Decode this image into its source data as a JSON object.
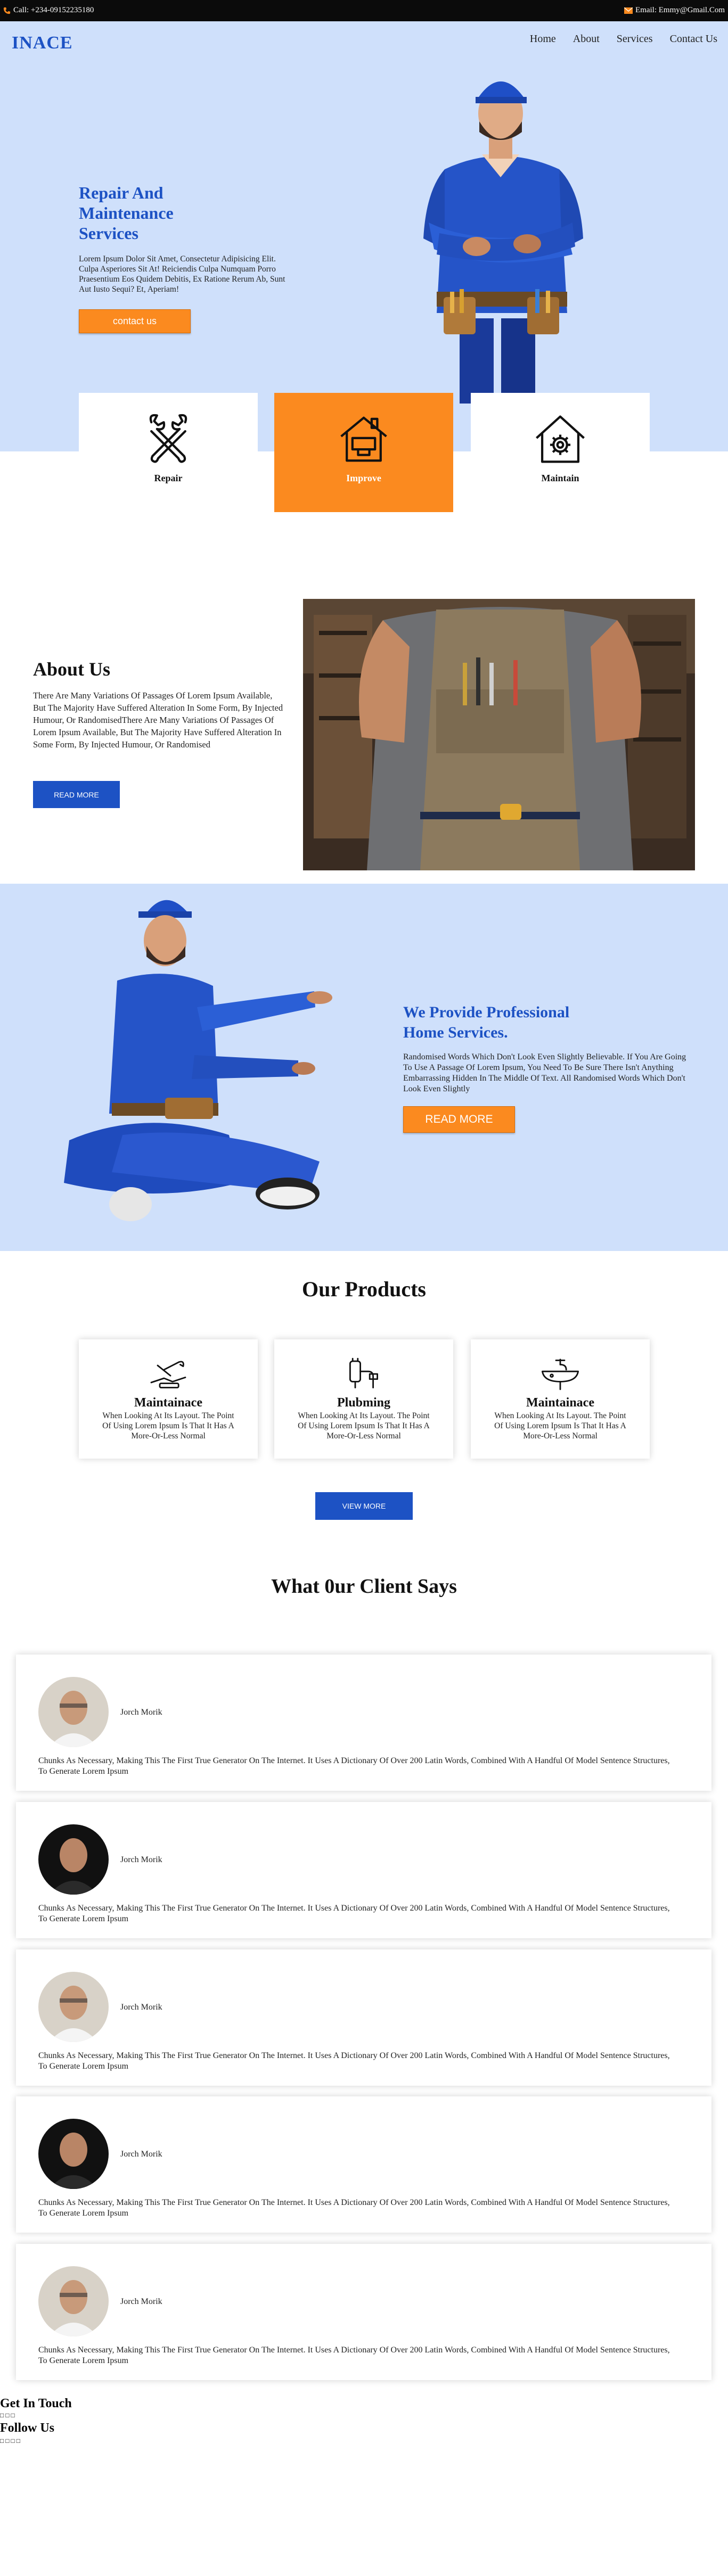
{
  "topbar": {
    "phone": "Call: +234-09152235180",
    "email": "Email: Emmy@Gmail.Com"
  },
  "header": {
    "logo": "INACE",
    "nav": [
      "Home",
      "About",
      "Services",
      "Contact Us"
    ]
  },
  "hero": {
    "title": "Repair And Maintenance Services",
    "text": "Lorem Ipsum Dolor Sit Amet, Consectetur Adipisicing Elit. Culpa Asperiores Sit At! Reiciendis Culpa Numquam Porro Praesentium Eos Quidem Debitis, Ex Ratione Rerum Ab, Sunt Aut Iusto Sequi? Et, Aperiam!",
    "button": "contact us"
  },
  "features": [
    {
      "label": "Repair",
      "icon": "wrench-cross-icon",
      "active": false
    },
    {
      "label": "Improve",
      "icon": "house-paint-icon",
      "active": true
    },
    {
      "label": "Maintain",
      "icon": "house-gear-icon",
      "active": false
    }
  ],
  "about": {
    "title": "About Us",
    "text": "There Are Many Variations Of Passages Of Lorem Ipsum Available, But The Majority Have Suffered Alteration In Some Form, By Injected Humour, Or RandomisedThere Are Many Variations Of Passages Of Lorem Ipsum Available, But The Majority Have Suffered Alteration In Some Form, By Injected Humour, Or Randomised",
    "button": "READ MORE"
  },
  "services": {
    "title": "We Provide Professional Home Services.",
    "text": "Randomised Words Which Don't Look Even Slightly Believable. If You Are Going To Use A Passage Of Lorem Ipsum, You Need To Be Sure There Isn't Anything Embarrassing Hidden In The Middle Of Text. All Randomised Words Which Don't Look Even Slightly",
    "button": "READ MORE"
  },
  "products": {
    "title": "Our Products",
    "items": [
      {
        "title": "Maintainace",
        "icon": "tools-icon",
        "text": "When Looking At Its Layout. The Point Of Using Lorem Ipsum Is That It Has A More-Or-Less Normal"
      },
      {
        "title": "Plubming",
        "icon": "plumbing-icon",
        "text": "When Looking At Its Layout. The Point Of Using Lorem Ipsum Is That It Has A More-Or-Less Normal"
      },
      {
        "title": "Maintainace",
        "icon": "sink-icon",
        "text": "When Looking At Its Layout. The Point Of Using Lorem Ipsum Is That It Has A More-Or-Less Normal"
      }
    ],
    "button": "VIEW MORE"
  },
  "testimonials": {
    "title": "What 0ur Client Says",
    "items": [
      {
        "name": "Jorch Morik",
        "quote": "Chunks As Necessary, Making This The First True Generator On The Internet. It Uses A Dictionary Of Over 200 Latin Words, Combined With A Handful Of Model Sentence Structures, To Generate Lorem Ipsum"
      },
      {
        "name": "Jorch Morik",
        "quote": "Chunks As Necessary, Making This The First True Generator On The Internet. It Uses A Dictionary Of Over 200 Latin Words, Combined With A Handful Of Model Sentence Structures, To Generate Lorem Ipsum"
      },
      {
        "name": "Jorch Morik",
        "quote": "Chunks As Necessary, Making This The First True Generator On The Internet. It Uses A Dictionary Of Over 200 Latin Words, Combined With A Handful Of Model Sentence Structures, To Generate Lorem Ipsum"
      },
      {
        "name": "Jorch Morik",
        "quote": "Chunks As Necessary, Making This The First True Generator On The Internet. It Uses A Dictionary Of Over 200 Latin Words, Combined With A Handful Of Model Sentence Structures, To Generate Lorem Ipsum"
      },
      {
        "name": "Jorch Morik",
        "quote": "Chunks As Necessary, Making This The First True Generator On The Internet. It Uses A Dictionary Of Over 200 Latin Words, Combined With A Handful Of Model Sentence Structures, To Generate Lorem Ipsum"
      }
    ]
  },
  "footer": {
    "get_in_touch": "Get In Touch",
    "follow_us": "Follow Us"
  },
  "colors": {
    "brand_blue": "#1d52c4",
    "accent_orange": "#fb8a1f",
    "hero_bg": "#cfe0fb"
  }
}
